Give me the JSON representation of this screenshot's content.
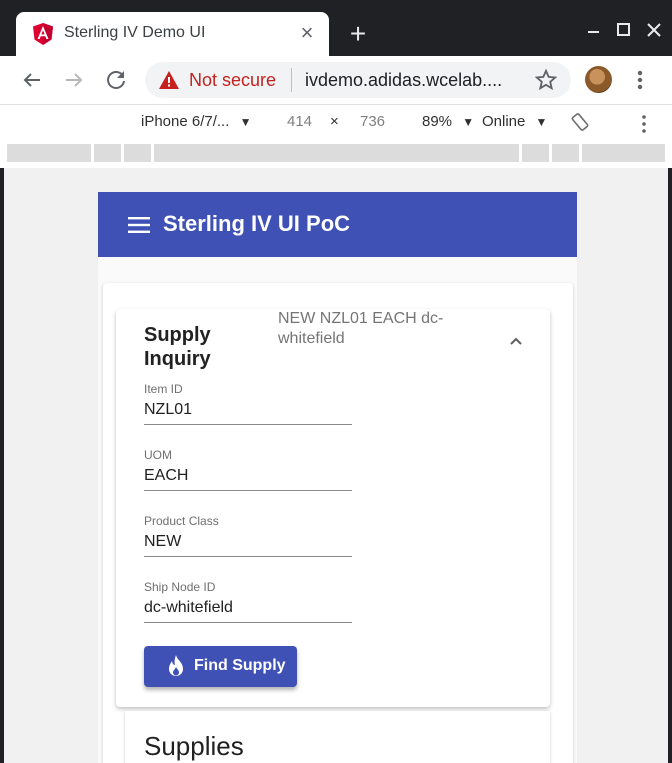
{
  "browser": {
    "tab_title": "Sterling IV Demo UI",
    "tab_close": "×",
    "new_tab": "+",
    "security_label": "Not secure",
    "url": "ivdemo.adidas.wcelab...."
  },
  "device_toolbar": {
    "device": "iPhone 6/7/...",
    "width": "414",
    "times": "×",
    "height": "736",
    "zoom": "89%",
    "network": "Online",
    "dropdown_arrow": "▼"
  },
  "app": {
    "title": "Sterling IV UI PoC",
    "panel": {
      "title": "Supply Inquiry",
      "description": "NEW NZL01 EACH dc-whitefield",
      "fields": [
        {
          "label": "Item ID",
          "value": "NZL01"
        },
        {
          "label": "UOM",
          "value": "EACH"
        },
        {
          "label": "Product Class",
          "value": "NEW"
        },
        {
          "label": "Ship Node ID",
          "value": "dc-whitefield"
        }
      ],
      "button_label": "Find Supply"
    },
    "supplies_title": "Supplies"
  },
  "colors": {
    "primary": "#3f51b5",
    "warning": "#c5221f"
  }
}
